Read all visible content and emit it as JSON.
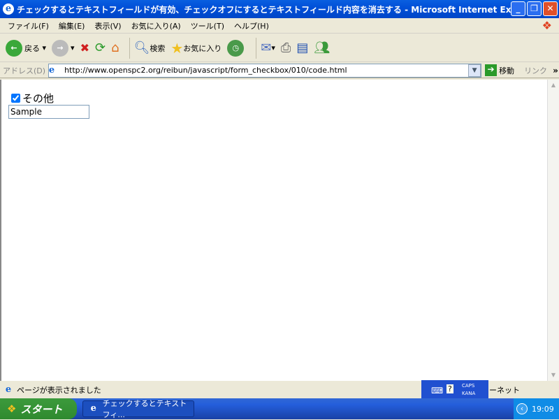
{
  "window": {
    "title": "チェックするとテキストフィールドが有効、チェックオフにするとテキストフィールド内容を消去する - Microsoft Internet Explorer"
  },
  "menu": [
    "ファイル(F)",
    "編集(E)",
    "表示(V)",
    "お気に入り(A)",
    "ツール(T)",
    "ヘルプ(H)"
  ],
  "toolbar": {
    "back": "戻る",
    "search": "検索",
    "favorites": "お気に入り"
  },
  "address": {
    "label": "アドレス(D)",
    "url": "http://www.openspc2.org/reibun/javascript/form_checkbox/010/code.html",
    "go": "移動",
    "links": "リンク"
  },
  "page": {
    "checkbox_label": "その他",
    "checked": true,
    "text_value": "Sample"
  },
  "status": {
    "text": "ページが表示されました",
    "zone": "ーネット",
    "caps": "CAPS",
    "kana": "KANA"
  },
  "taskbar": {
    "start": "スタート",
    "task": "チェックするとテキストフィ...",
    "clock": "19:09"
  }
}
